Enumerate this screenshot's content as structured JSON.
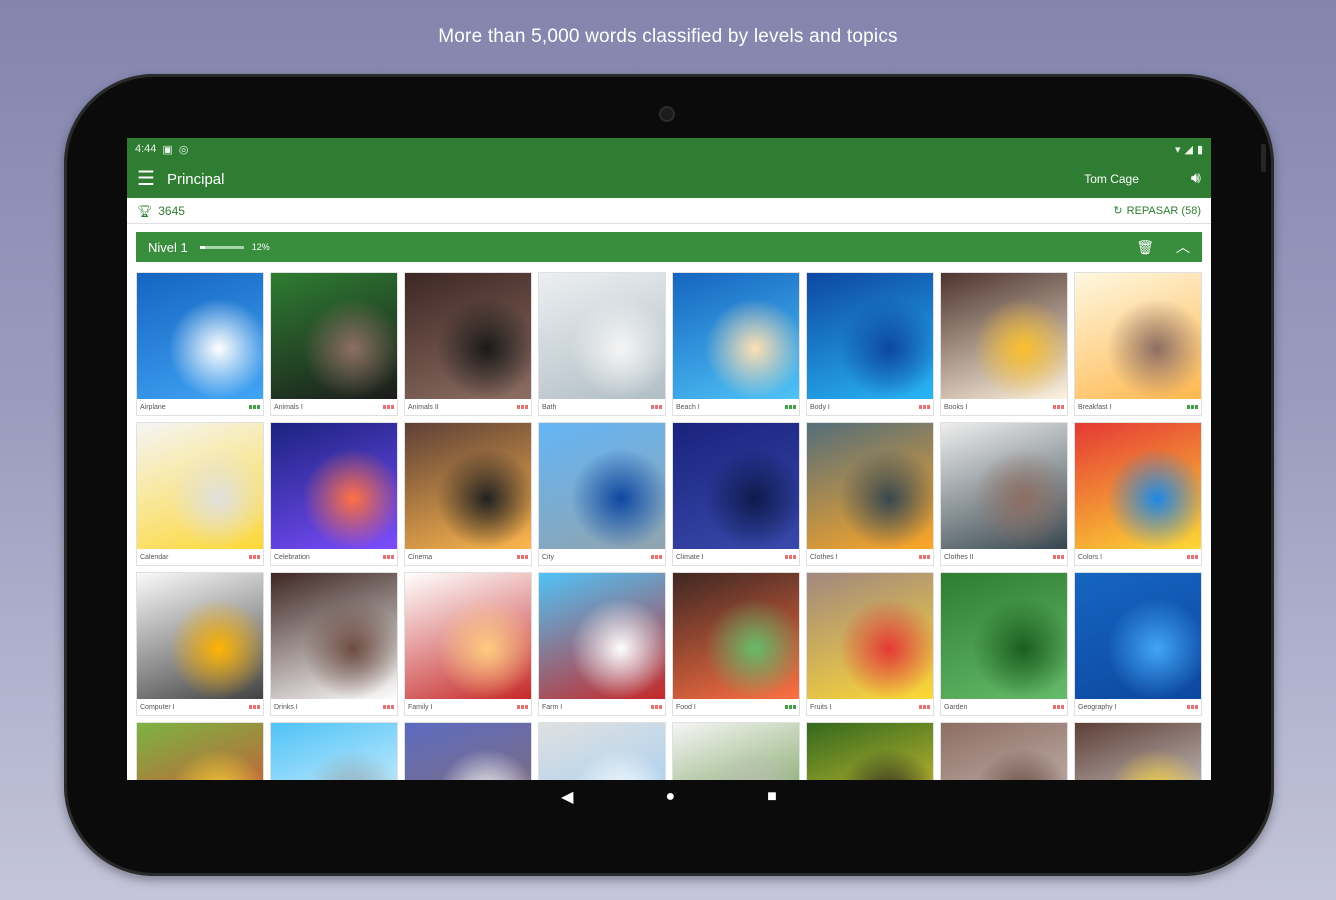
{
  "headline": "More than 5,000 words classified by levels and topics",
  "statusbar": {
    "time": "4:44",
    "icons": [
      "sd-card-icon",
      "gps-icon"
    ],
    "right_icons": [
      "wifi-icon",
      "signal-icon",
      "battery-icon"
    ]
  },
  "appbar": {
    "title": "Principal",
    "user": "Tom Cage"
  },
  "scorebar": {
    "points": "3645",
    "review_label": "REPASAR (58)"
  },
  "level": {
    "label": "Nivel 1",
    "percent_text": "12%",
    "progress": 0.12
  },
  "colors": {
    "primary": "#2e7d32",
    "level_bar": "#388e3c",
    "dot_red": "#e57373",
    "dot_green": "#43a047"
  },
  "topics": [
    {
      "caption": "Airplane",
      "dots": "green",
      "colors": [
        "#1565c0",
        "#42a5f5",
        "#ffffff"
      ]
    },
    {
      "caption": "Animals I",
      "dots": "red",
      "colors": [
        "#2e7d32",
        "#1b1b1b",
        "#8d6e63"
      ]
    },
    {
      "caption": "Animals II",
      "dots": "red",
      "colors": [
        "#3e2723",
        "#8d6e63",
        "#1a1a1a"
      ]
    },
    {
      "caption": "Bath",
      "dots": "red",
      "colors": [
        "#eceff1",
        "#b0bec5",
        "#f5f5f5"
      ]
    },
    {
      "caption": "Beach I",
      "dots": "green",
      "colors": [
        "#1565c0",
        "#4fc3f7",
        "#ffe0b2"
      ]
    },
    {
      "caption": "Body I",
      "dots": "red",
      "colors": [
        "#0d47a1",
        "#29b6f6",
        "#0d47a1"
      ]
    },
    {
      "caption": "Books I",
      "dots": "red",
      "colors": [
        "#4e342e",
        "#fff3e0",
        "#fbc02d"
      ]
    },
    {
      "caption": "Breakfast I",
      "dots": "green",
      "colors": [
        "#fff8e1",
        "#ffb74d",
        "#8d6e63"
      ]
    },
    {
      "caption": "Calendar",
      "dots": "red",
      "colors": [
        "#f5f5f5",
        "#fdd835",
        "#e0e0e0"
      ]
    },
    {
      "caption": "Celebration",
      "dots": "red",
      "colors": [
        "#1a237e",
        "#7c4dff",
        "#ff7043"
      ]
    },
    {
      "caption": "Cinema",
      "dots": "red",
      "colors": [
        "#5d4037",
        "#ffb74d",
        "#212121"
      ]
    },
    {
      "caption": "City",
      "dots": "red",
      "colors": [
        "#64b5f6",
        "#90a4ae",
        "#0d47a1"
      ]
    },
    {
      "caption": "Climate I",
      "dots": "red",
      "colors": [
        "#1a237e",
        "#3949ab",
        "#0d1b4d"
      ]
    },
    {
      "caption": "Clothes I",
      "dots": "red",
      "colors": [
        "#546e7a",
        "#ffa726",
        "#37474f"
      ]
    },
    {
      "caption": "Clothes II",
      "dots": "red",
      "colors": [
        "#eeeeee",
        "#37474f",
        "#8d6e63"
      ]
    },
    {
      "caption": "Colors I",
      "dots": "red",
      "colors": [
        "#e53935",
        "#fdd835",
        "#1e88e5"
      ]
    },
    {
      "caption": "Computer I",
      "dots": "red",
      "colors": [
        "#fafafa",
        "#424242",
        "#ffb300"
      ]
    },
    {
      "caption": "Drinks I",
      "dots": "red",
      "colors": [
        "#3e2723",
        "#ffffff",
        "#6d4c41"
      ]
    },
    {
      "caption": "Family I",
      "dots": "red",
      "colors": [
        "#ffffff",
        "#c62828",
        "#ffcc80"
      ]
    },
    {
      "caption": "Farm I",
      "dots": "red",
      "colors": [
        "#4fc3f7",
        "#c62828",
        "#ffffff"
      ]
    },
    {
      "caption": "Food I",
      "dots": "green",
      "colors": [
        "#3e2723",
        "#ff7043",
        "#66bb6a"
      ]
    },
    {
      "caption": "Fruits I",
      "dots": "red",
      "colors": [
        "#a1887f",
        "#fdd835",
        "#e53935"
      ]
    },
    {
      "caption": "Garden",
      "dots": "red",
      "colors": [
        "#2e7d32",
        "#66bb6a",
        "#1b5e20"
      ]
    },
    {
      "caption": "Geography I",
      "dots": "red",
      "colors": [
        "#1565c0",
        "#0d47a1",
        "#42a5f5"
      ]
    },
    {
      "caption": "",
      "dots": "none",
      "colors": [
        "#7cb342",
        "#e53935",
        "#fdd835"
      ]
    },
    {
      "caption": "",
      "dots": "none",
      "colors": [
        "#4fc3f7",
        "#ffffff",
        "#90a4ae"
      ]
    },
    {
      "caption": "",
      "dots": "none",
      "colors": [
        "#5c6bc0",
        "#8d6e63",
        "#ffffff"
      ]
    },
    {
      "caption": "",
      "dots": "none",
      "colors": [
        "#e0e0e0",
        "#90caf9",
        "#ffffff"
      ]
    },
    {
      "caption": "",
      "dots": "none",
      "colors": [
        "#f5f5f5",
        "#558b2f",
        "#bdbdbd"
      ]
    },
    {
      "caption": "",
      "dots": "none",
      "colors": [
        "#33691e",
        "#fdd835",
        "#212121"
      ]
    },
    {
      "caption": "",
      "dots": "none",
      "colors": [
        "#8d6e63",
        "#d7ccc8",
        "#5d4037"
      ]
    },
    {
      "caption": "",
      "dots": "none",
      "colors": [
        "#5d4037",
        "#f5f5f5",
        "#fdd835"
      ]
    }
  ]
}
